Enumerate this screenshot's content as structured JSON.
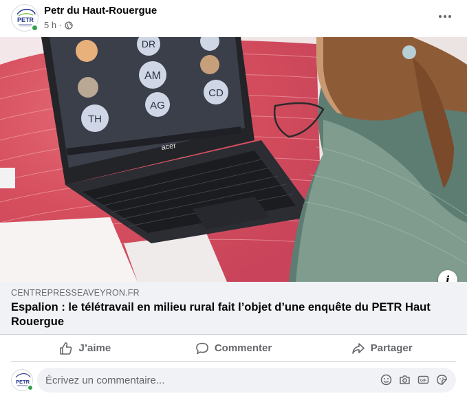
{
  "post": {
    "page_name": "Petr du Haut-Rouergue",
    "time": "5 h",
    "separator": "·",
    "audience_icon": "globe-icon",
    "avatar_text": "PETR"
  },
  "image": {
    "laptop_brand": "acer",
    "participants": [
      "DR",
      "AM",
      "CD",
      "AG",
      "TH"
    ]
  },
  "link_preview": {
    "domain": "CENTREPRESSEAVEYRON.FR",
    "title": "Espalion : le télétravail en milieu rural fait l’objet d’une enquête du PETR Haut Rouergue"
  },
  "actions": {
    "like_label": "J’aime",
    "comment_label": "Commenter",
    "share_label": "Partager"
  },
  "comment": {
    "placeholder": "Écrivez un commentaire...",
    "icons": [
      "emoji-icon",
      "camera-icon",
      "gif-icon",
      "sticker-icon"
    ]
  },
  "colors": {
    "secondary_text": "#65676b",
    "online": "#31a24c",
    "link_bg": "#f0f2f5"
  }
}
